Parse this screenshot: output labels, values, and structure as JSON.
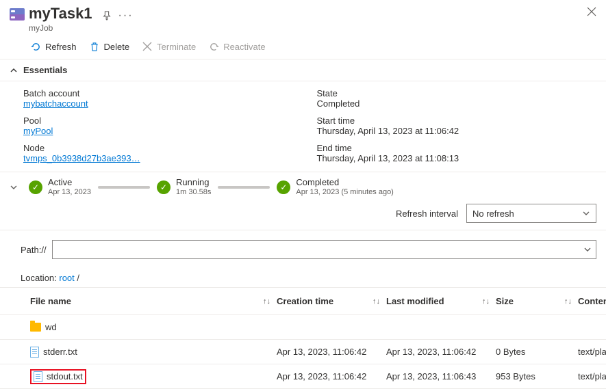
{
  "header": {
    "title": "myTask1",
    "subtitle": "myJob"
  },
  "toolbar": {
    "refresh": "Refresh",
    "delete": "Delete",
    "terminate": "Terminate",
    "reactivate": "Reactivate"
  },
  "essentials": {
    "heading": "Essentials",
    "left": {
      "batch_account_label": "Batch account",
      "batch_account_value": "mybatchaccount",
      "pool_label": "Pool",
      "pool_value": "myPool",
      "node_label": "Node",
      "node_value": "tvmps_0b3938d27b3ae393…"
    },
    "right": {
      "state_label": "State",
      "state_value": "Completed",
      "start_label": "Start time",
      "start_value": "Thursday, April 13, 2023 at 11:06:42",
      "end_label": "End time",
      "end_value": "Thursday, April 13, 2023 at 11:08:13"
    }
  },
  "timeline": [
    {
      "name": "Active",
      "sub": "Apr 13, 2023"
    },
    {
      "name": "Running",
      "sub": "1m 30.58s"
    },
    {
      "name": "Completed",
      "sub": "Apr 13, 2023 (5 minutes ago)"
    }
  ],
  "refresh_interval": {
    "label": "Refresh interval",
    "value": "No refresh"
  },
  "path": {
    "label": "Path://",
    "value": ""
  },
  "location": {
    "prefix": "Location: ",
    "root": "root",
    "suffix": " /"
  },
  "table": {
    "headers": {
      "name": "File name",
      "created": "Creation time",
      "modified": "Last modified",
      "size": "Size",
      "content": "Conten"
    },
    "rows": [
      {
        "type": "folder",
        "name": "wd",
        "created": "",
        "modified": "",
        "size": "",
        "content": "",
        "highlight": false
      },
      {
        "type": "file",
        "name": "stderr.txt",
        "created": "Apr 13, 2023, 11:06:42",
        "modified": "Apr 13, 2023, 11:06:42",
        "size": "0 Bytes",
        "content": "text/pla",
        "highlight": false
      },
      {
        "type": "file",
        "name": "stdout.txt",
        "created": "Apr 13, 2023, 11:06:42",
        "modified": "Apr 13, 2023, 11:06:43",
        "size": "953 Bytes",
        "content": "text/pla",
        "highlight": true
      }
    ]
  }
}
